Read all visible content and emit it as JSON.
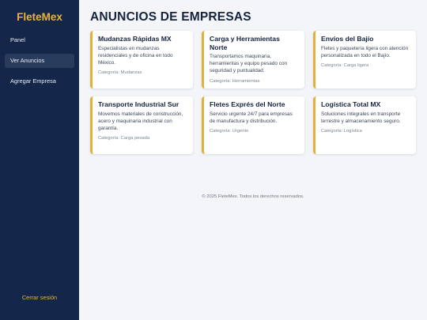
{
  "brand": "FleteMex",
  "nav": [
    {
      "label": "Panel",
      "active": false
    },
    {
      "label": "Ver Anuncios",
      "active": true
    },
    {
      "label": "Agregar Empresa",
      "active": false
    }
  ],
  "logout_label": "Cerrar sesión",
  "page_title": "ANUNCIOS DE EMPRESAS",
  "cards": [
    {
      "title": "Mudanzas Rápidas MX",
      "description": "Especialistas en mudanzas residenciales y de oficina en todo México.",
      "category": "Categoría: Mudanzas"
    },
    {
      "title": "Carga y Herramientas Norte",
      "description": "Transportamos maquinaria, herramientas y equipo pesado con seguridad y puntualidad.",
      "category": "Categoría: Herramientas"
    },
    {
      "title": "Envíos del Bajío",
      "description": "Fletes y paquetería ligera con atención personalizada en todo el Bajío.",
      "category": "Categoría: Carga ligera"
    },
    {
      "title": "Transporte Industrial Sur",
      "description": "Movemos materiales de construcción, acero y maquinaria industrial con garantía.",
      "category": "Categoría: Carga pesada"
    },
    {
      "title": "Fletes Exprés del Norte",
      "description": "Servicio urgente 24/7 para empresas de manufactura y distribución.",
      "category": "Categoría: Urgente"
    },
    {
      "title": "Logística Total MX",
      "description": "Soluciones integrales en transporte terrestre y almacenamiento seguro.",
      "category": "Categoría: Logística"
    }
  ],
  "footer": "© 2025 FleteMex. Todos los derechos reservados.",
  "colors": {
    "sidebar": "#14274a",
    "accent": "#e2b13c",
    "background": "#f3f5f8"
  }
}
